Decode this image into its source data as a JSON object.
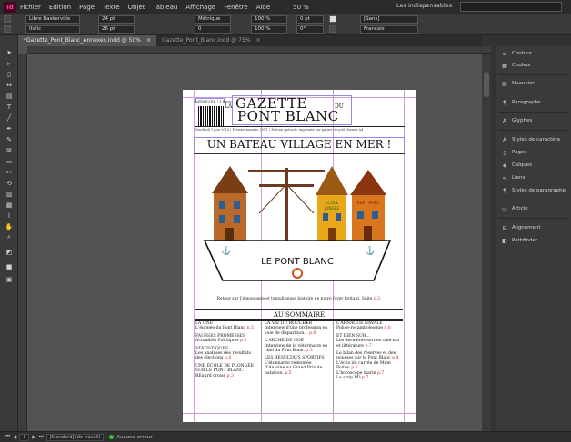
{
  "app": {
    "logo": "Id",
    "zoom": "50 %",
    "workspace": "Les indispensables"
  },
  "menu": [
    "Fichier",
    "Edition",
    "Page",
    "Texte",
    "Objet",
    "Tableau",
    "Affichage",
    "Fenêtre",
    "Aide"
  ],
  "control": {
    "font_family": "Libre Baskerville",
    "font_style": "Italic",
    "font_size": "24 pt",
    "leading": "26 pt",
    "kerning": "Métrique",
    "tracking": "0",
    "scale_v": "100 %",
    "scale_h": "100 %",
    "baseline": "0 pt",
    "angle": "0°",
    "style": "[Sans]",
    "language": "Français"
  },
  "tabs": [
    {
      "label": "*Gazette_Pont_Blanc_Annexes.indd @ 50%",
      "close": "×"
    },
    {
      "label": "Gazette_Pont_Blanc.indd @ 75%",
      "close": "×"
    }
  ],
  "page": {
    "issue": "MENSUEL | 1 Euro",
    "mast_la": "LA",
    "mast_gazette": "GAZETTE",
    "mast_du": "DU",
    "mast_pontblanc": "PONT BLANC",
    "infoline": "Vendredi 1 juin 2018 | Premier numéro | N°1 | Édition spéciale, imprimée sur papier recyclé, format A4",
    "headline": "UN BATEAU VILLAGE EN MER !",
    "drawing": {
      "boat_text": "LE PONT BLANC",
      "house_text_1": "ECOLE",
      "house_text_2": "JUNGLE",
      "house_text_3": "VERT PONT"
    },
    "caption": "Retour sur l'émouvante et tumultueuse histoire de notre foyer flottant. Suite",
    "caption_page": "p.3.",
    "sommaire": "AU SOMMAIRE",
    "columns": [
      [
        {
          "title": "LA UNE",
          "text": "L'épopée du Pont Blanc",
          "page": "p.3"
        },
        {
          "title": "FAUSSES PROMESSES",
          "text": "Actualités Politiques",
          "page": "p.2"
        },
        {
          "title": "STATISTIQUES",
          "text": "Les analyses des résultats des élections",
          "page": "p.8"
        },
        {
          "title": "UNE ÉCOLE DE PLONGÉE SUR LE PONT BLANC",
          "text": "REaurd croisé",
          "page": "p.3"
        }
      ],
      [
        {
          "title": "LA VIE DU ROUCHER",
          "text": "Interview d'une profession en voie de disparition...",
          "page": "p.6"
        },
        {
          "title": "L'ARCHE DE NOÉ",
          "text": "Interview de la vétérinaire en chef du Pont Blanc",
          "page": "p.3"
        },
        {
          "title": "LES RÉSULTATS SPORTIFS",
          "text": "L'étonnante remontée d'Antoine au Grand Prix de natation.",
          "page": "p.5"
        }
      ],
      [
        {
          "title": "L'ARNAQUE NAVALE",
          "text": "Police-rocambolesque",
          "page": "p.6"
        },
        {
          "title": "ET BIEN SUR...",
          "text": "Les dernières sorties ciné-ma et littérature",
          "page": "p.7"
        },
        {
          "title": "",
          "text": "Le bilan des réserves et des pousses sur le Pont Blanc",
          "page": "p.4"
        },
        {
          "title": "",
          "text": "L'écho du carrée de Mme Poitou",
          "page": "p.6"
        },
        {
          "title": "",
          "text": "L'horoscope marin",
          "page": "p.7"
        },
        {
          "title": "",
          "text": "Le strip BD",
          "page": "p.7"
        }
      ]
    ]
  },
  "panels": [
    {
      "icon": "stroke-icon",
      "glyph": "≡",
      "label": "Contour"
    },
    {
      "icon": "swatch-icon",
      "glyph": "▦",
      "label": "Couleur"
    },
    {
      "icon": "swatches-icon",
      "glyph": "▤",
      "label": "Nuancier"
    },
    {
      "icon": "paragraph-icon",
      "glyph": "¶",
      "label": "Paragraphe"
    },
    {
      "icon": "glyphs-icon",
      "glyph": "A",
      "label": "Glyphes"
    },
    {
      "icon": "char-styles-icon",
      "glyph": "A",
      "label": "Styles de caractère"
    },
    {
      "icon": "pages-icon",
      "glyph": "▯",
      "label": "Pages"
    },
    {
      "icon": "layers-icon",
      "glyph": "◈",
      "label": "Calques"
    },
    {
      "icon": "links-icon",
      "glyph": "∞",
      "label": "Liens"
    },
    {
      "icon": "para-styles-icon",
      "glyph": "¶",
      "label": "Styles de paragraphe"
    },
    {
      "icon": "article-icon",
      "glyph": "▭",
      "label": "Article"
    },
    {
      "icon": "align-icon",
      "glyph": "⊟",
      "label": "Alignement"
    },
    {
      "icon": "pathfinder-icon",
      "glyph": "◧",
      "label": "Pathfinder"
    }
  ],
  "status": {
    "page_num": "1",
    "mode": "[Standard] (de travail)",
    "errors": "Aucune erreur"
  },
  "colors": {
    "accent": "#ff3fa4",
    "page_numbers": "#d42020",
    "ok": "#38c33a"
  }
}
